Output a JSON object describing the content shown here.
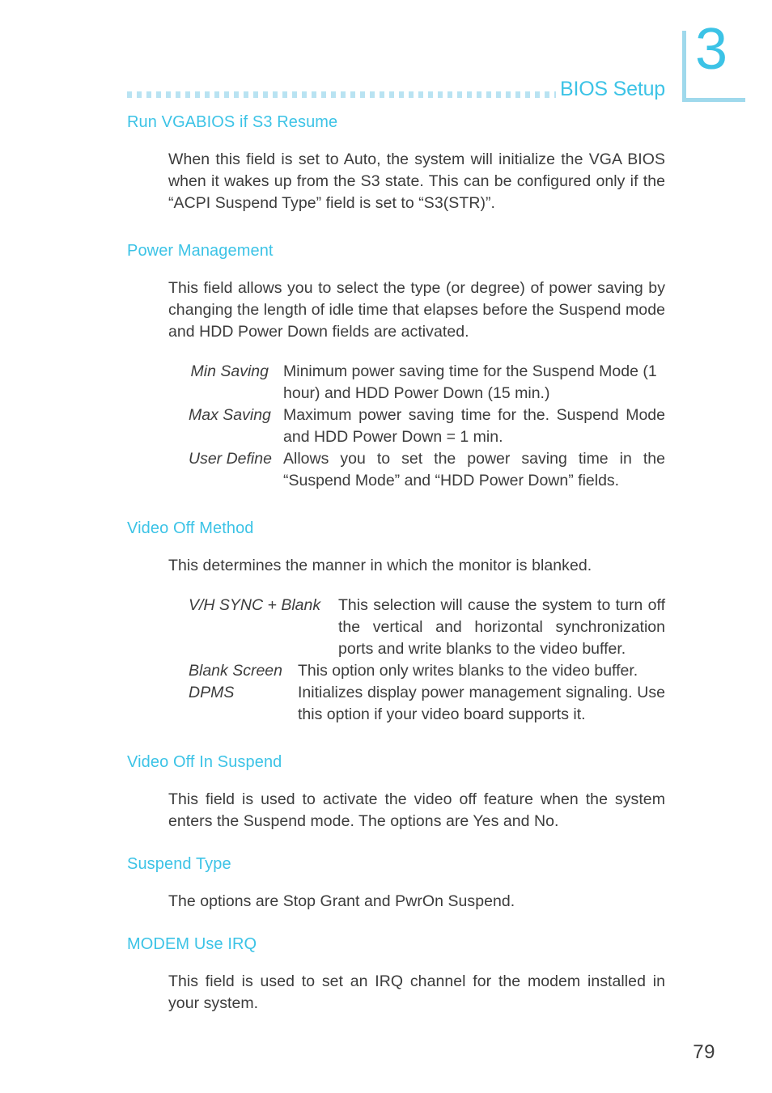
{
  "header": {
    "title": "BIOS Setup",
    "chapter_number": "3",
    "rule_icon": "dotted-rule",
    "accent_color": "#3cc3e6",
    "rule_color": "#b9e3f2",
    "bracket_color": "#9fd9ec"
  },
  "footer": {
    "page_number": "79"
  },
  "sections": [
    {
      "heading": "Run VGABIOS if S3 Resume",
      "paragraphs": [
        "When this field is set to Auto, the system will initialize the VGA BIOS when it wakes up from the S3 state. This can be configured only if the “ACPI Suspend Type” field is set to “S3(STR)”."
      ]
    },
    {
      "heading": "Power Management",
      "paragraphs": [
        "This field allows you to select the type (or degree) of power saving by changing the length of idle time that elapses before the Suspend mode and HDD Power Down fields are activated."
      ],
      "definitions": [
        {
          "term": "Min Saving",
          "description": "Minimum power saving time for the Suspend Mode (1 hour) and HDD Power Down (15 min.)"
        },
        {
          "term": "Max Saving",
          "description": "Maximum power saving time for the. Suspend Mode and HDD Power Down = 1 min."
        },
        {
          "term": "User Define",
          "description": "Allows you to set the power saving time in the “Suspend Mode” and “HDD Power Down” fields."
        }
      ]
    },
    {
      "heading": "Video Off Method",
      "paragraphs": [
        "This determines the manner in which the monitor is blanked."
      ],
      "definitions": [
        {
          "term": "V/H SYNC + Blank",
          "description": "This selection will cause the system to turn off the vertical and horizontal synchronization ports and write blanks to the video buffer."
        },
        {
          "term": "Blank Screen",
          "description": "This option only writes blanks to the video buffer."
        },
        {
          "term": "DPMS",
          "description": "Initializes display power management signaling. Use this option if your video board supports it."
        }
      ]
    },
    {
      "heading": "Video Off In Suspend",
      "paragraphs": [
        "This field is used to activate the video off feature when the system enters the Suspend mode. The options are Yes and No."
      ]
    },
    {
      "heading": "Suspend Type",
      "paragraphs": [
        "The options are Stop Grant and PwrOn Suspend."
      ]
    },
    {
      "heading": "MODEM Use IRQ",
      "paragraphs": [
        "This field is used to set an IRQ channel for the modem installed in your system."
      ]
    }
  ]
}
